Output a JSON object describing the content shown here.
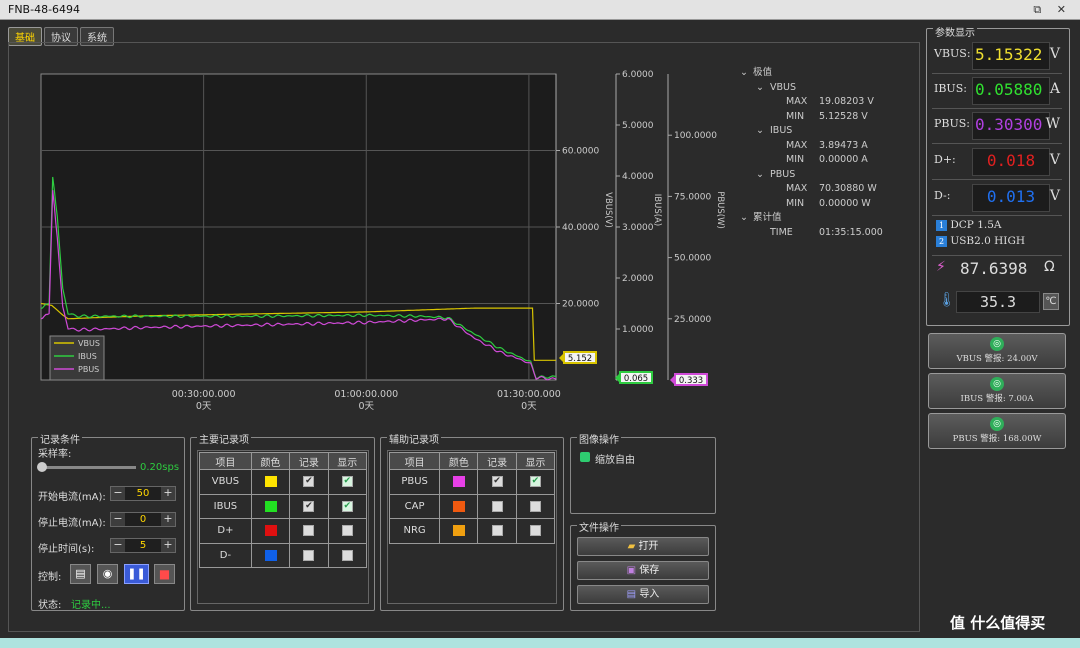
{
  "window": {
    "title": "FNB-48-6494",
    "controls": "⧉ ✕"
  },
  "tabs": [
    {
      "label": "基础",
      "active": true
    },
    {
      "label": "协议",
      "active": false
    },
    {
      "label": "系统",
      "active": false
    }
  ],
  "chart_data": {
    "type": "line",
    "x_ticks": [
      {
        "t": "00:30:00.000",
        "d": "0天"
      },
      {
        "t": "01:00:00.000",
        "d": "0天"
      },
      {
        "t": "01:30:00.000",
        "d": "0天"
      }
    ],
    "xlim_seconds": [
      0,
      5700
    ],
    "axes": [
      {
        "name": "VBUS(V)",
        "ylim": [
          0,
          80
        ],
        "ticks": [
          "60.0000",
          "40.0000",
          "20.0000"
        ],
        "color": "#d8c400",
        "marker": "5.152"
      },
      {
        "name": "IBUS(A)",
        "ylim": [
          0,
          6
        ],
        "ticks": [
          "6.0000",
          "5.0000",
          "4.0000",
          "3.0000",
          "2.0000",
          "1.0000",
          "0.0000"
        ],
        "color": "#2ecc40",
        "marker": "0.065"
      },
      {
        "name": "PBUS(W)",
        "ylim": [
          0,
          125
        ],
        "ticks": [
          "100.0000",
          "75.0000",
          "50.0000",
          "25.0000"
        ],
        "color": "#d04ad8",
        "marker": "0.333"
      }
    ],
    "series": [
      {
        "name": "VBUS",
        "color": "#d8c400",
        "axis": 0,
        "x": [
          0,
          120,
          240,
          300,
          600,
          1200,
          2400,
          3600,
          4200,
          4800,
          5400,
          5440,
          5460,
          5700
        ],
        "y": [
          20,
          19.5,
          17,
          16,
          16.3,
          16.8,
          17.3,
          17.8,
          18.3,
          18.8,
          18.8,
          18.8,
          5.15,
          5.15
        ]
      },
      {
        "name": "IBUS",
        "color": "#2ecc40",
        "axis": 1,
        "x": [
          0,
          90,
          130,
          180,
          240,
          300,
          420,
          1200,
          2400,
          3600,
          4200,
          4500,
          4800,
          5100,
          5300,
          5420,
          5480,
          5700
        ],
        "y": [
          1.4,
          1.5,
          4.0,
          3.2,
          1.8,
          1.3,
          1.25,
          1.25,
          1.25,
          1.27,
          1.25,
          1.22,
          0.9,
          0.6,
          0.45,
          0.35,
          0.05,
          0.065
        ]
      },
      {
        "name": "PBUS",
        "color": "#d04ad8",
        "axis": 2,
        "x": [
          0,
          90,
          130,
          180,
          240,
          300,
          420,
          1200,
          2400,
          3600,
          4200,
          4500,
          4800,
          5100,
          5300,
          5420,
          5480,
          5700
        ],
        "y": [
          25,
          27,
          78,
          58,
          30,
          21,
          20.5,
          21.5,
          22.5,
          23.5,
          24.5,
          25,
          17,
          11,
          8.5,
          6.5,
          1,
          0.33
        ]
      }
    ],
    "legend": [
      "VBUS",
      "IBUS",
      "PBUS"
    ],
    "legend_position": "bottom-left"
  },
  "extremes": {
    "title": "极值",
    "groups": [
      {
        "name": "VBUS",
        "rows": [
          {
            "k": "MAX",
            "v": "19.08203 V"
          },
          {
            "k": "MIN",
            "v": "5.12528 V"
          }
        ]
      },
      {
        "name": "IBUS",
        "rows": [
          {
            "k": "MAX",
            "v": "3.89473 A"
          },
          {
            "k": "MIN",
            "v": "0.00000 A"
          }
        ]
      },
      {
        "name": "PBUS",
        "rows": [
          {
            "k": "MAX",
            "v": "70.30880 W"
          },
          {
            "k": "MIN",
            "v": "0.00000 W"
          }
        ]
      }
    ],
    "cum_title": "累计值",
    "time": {
      "k": "TIME",
      "v": "01:35:15.000"
    }
  },
  "record": {
    "title": "记录条件",
    "rate_label": "采样率:",
    "rate_value": "0.20sps",
    "start_label": "开始电流(mA):",
    "start_value": "50",
    "stop_label": "停止电流(mA):",
    "stop_value": "0",
    "time_label": "停止时间(s):",
    "time_value": "5",
    "control_label": "控制:",
    "status_label": "状态:",
    "status_value": "记录中..."
  },
  "main_items": {
    "title": "主要记录项",
    "headers": [
      "项目",
      "颜色",
      "记录",
      "显示"
    ],
    "rows": [
      {
        "name": "VBUS",
        "color": "#ffe400",
        "rec": true,
        "show": true
      },
      {
        "name": "IBUS",
        "color": "#22e022",
        "rec": true,
        "show": true
      },
      {
        "name": "D+",
        "color": "#e01010",
        "rec": false,
        "show": false
      },
      {
        "name": "D-",
        "color": "#1060e8",
        "rec": false,
        "show": false
      }
    ]
  },
  "aux_items": {
    "title": "辅助记录项",
    "headers": [
      "项目",
      "颜色",
      "记录",
      "显示"
    ],
    "rows": [
      {
        "name": "PBUS",
        "color": "#e840e8",
        "rec": true,
        "show": true
      },
      {
        "name": "CAP",
        "color": "#f05a10",
        "rec": false,
        "show": false
      },
      {
        "name": "NRG",
        "color": "#f0a010",
        "rec": false,
        "show": false
      }
    ]
  },
  "image_ops": {
    "title": "图像操作",
    "zoom_label": "缩放自由"
  },
  "file_ops": {
    "title": "文件操作",
    "open": "打开",
    "save": "保存",
    "import": "导入"
  },
  "params": {
    "title": "参数显示",
    "vbus": {
      "k": "VBUS:",
      "v": "5.15322",
      "u": "V",
      "color": "#f0e030"
    },
    "ibus": {
      "k": "IBUS:",
      "v": "0.05880",
      "u": "A",
      "color": "#30e030"
    },
    "pbus": {
      "k": "PBUS:",
      "v": "0.30300",
      "u": "W",
      "color": "#b040e0"
    },
    "dp": {
      "k": "D+:",
      "v": "0.018",
      "u": "V",
      "color": "#e02020"
    },
    "dm": {
      "k": "D-:",
      "v": "0.013",
      "u": "V",
      "color": "#2070f0"
    },
    "proto1": "DCP 1.5A",
    "proto2": "USB2.0 HIGH",
    "res": "87.6398",
    "res_unit": "Ω",
    "temp": "35.3",
    "temp_unit": "℃"
  },
  "alarms": [
    "VBUS 警报: 24.00V",
    "IBUS 警报: 7.00A",
    "PBUS 警报: 168.00W"
  ],
  "watermark": "值 什么值得买"
}
